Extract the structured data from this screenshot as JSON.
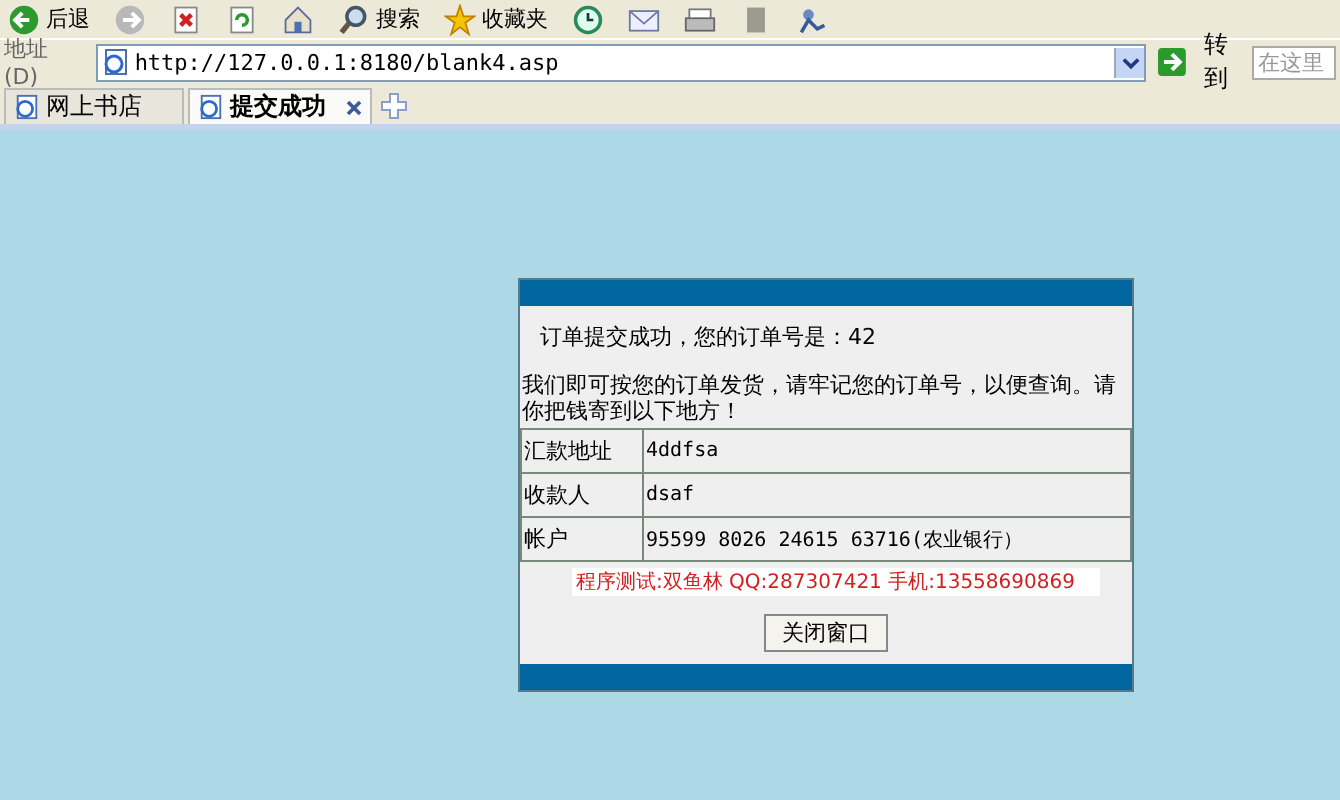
{
  "toolbar": {
    "buttons": [
      {
        "kind": "back",
        "label": "后退"
      },
      {
        "kind": "forward"
      },
      {
        "kind": "stop"
      },
      {
        "kind": "refresh"
      },
      {
        "kind": "home"
      },
      {
        "kind": "search",
        "label": "搜索"
      },
      {
        "kind": "favorites",
        "label": "收藏夹"
      },
      {
        "kind": "history"
      },
      {
        "kind": "mail"
      },
      {
        "kind": "print"
      },
      {
        "kind": "edit"
      },
      {
        "kind": "messenger"
      }
    ]
  },
  "address_bar": {
    "label": "地址 (D)",
    "value": "http://127.0.0.1:8180/blank4.asp",
    "go_button": "转到",
    "search_placeholder": "在这里"
  },
  "tabs": [
    {
      "label": "网上书店",
      "selected": false
    },
    {
      "label": "提交成功",
      "selected": true
    }
  ],
  "dialog": {
    "title": "订单提交成功，您的订单号是：42",
    "message": "我们即可按您的订单发货，请牢记您的订单号，以便查询。请你把钱寄到以下地方！",
    "rows": [
      {
        "label": "汇款地址",
        "value": "4ddfsa"
      },
      {
        "label": "收款人",
        "value": "dsaf"
      },
      {
        "label": "帐户",
        "value": "95599 8026 24615 63716(农业银行）"
      }
    ],
    "credit": "程序测试:双鱼林 QQ:287307421 手机:13558690869",
    "close_button": "关闭窗口"
  }
}
